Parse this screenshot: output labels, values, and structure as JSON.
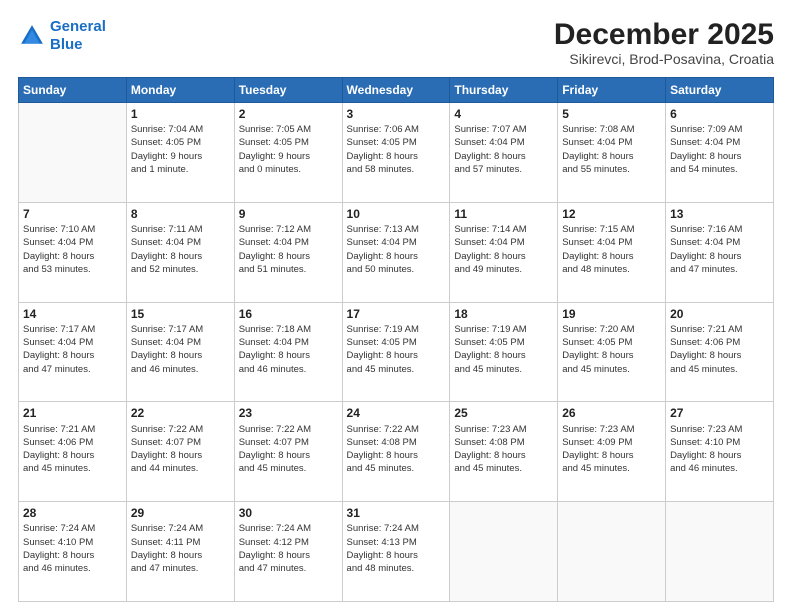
{
  "header": {
    "logo_line1": "General",
    "logo_line2": "Blue",
    "title": "December 2025",
    "subtitle": "Sikirevci, Brod-Posavina, Croatia"
  },
  "days_of_week": [
    "Sunday",
    "Monday",
    "Tuesday",
    "Wednesday",
    "Thursday",
    "Friday",
    "Saturday"
  ],
  "weeks": [
    [
      {
        "day": "",
        "info": ""
      },
      {
        "day": "1",
        "info": "Sunrise: 7:04 AM\nSunset: 4:05 PM\nDaylight: 9 hours\nand 1 minute."
      },
      {
        "day": "2",
        "info": "Sunrise: 7:05 AM\nSunset: 4:05 PM\nDaylight: 9 hours\nand 0 minutes."
      },
      {
        "day": "3",
        "info": "Sunrise: 7:06 AM\nSunset: 4:05 PM\nDaylight: 8 hours\nand 58 minutes."
      },
      {
        "day": "4",
        "info": "Sunrise: 7:07 AM\nSunset: 4:04 PM\nDaylight: 8 hours\nand 57 minutes."
      },
      {
        "day": "5",
        "info": "Sunrise: 7:08 AM\nSunset: 4:04 PM\nDaylight: 8 hours\nand 55 minutes."
      },
      {
        "day": "6",
        "info": "Sunrise: 7:09 AM\nSunset: 4:04 PM\nDaylight: 8 hours\nand 54 minutes."
      }
    ],
    [
      {
        "day": "7",
        "info": "Sunrise: 7:10 AM\nSunset: 4:04 PM\nDaylight: 8 hours\nand 53 minutes."
      },
      {
        "day": "8",
        "info": "Sunrise: 7:11 AM\nSunset: 4:04 PM\nDaylight: 8 hours\nand 52 minutes."
      },
      {
        "day": "9",
        "info": "Sunrise: 7:12 AM\nSunset: 4:04 PM\nDaylight: 8 hours\nand 51 minutes."
      },
      {
        "day": "10",
        "info": "Sunrise: 7:13 AM\nSunset: 4:04 PM\nDaylight: 8 hours\nand 50 minutes."
      },
      {
        "day": "11",
        "info": "Sunrise: 7:14 AM\nSunset: 4:04 PM\nDaylight: 8 hours\nand 49 minutes."
      },
      {
        "day": "12",
        "info": "Sunrise: 7:15 AM\nSunset: 4:04 PM\nDaylight: 8 hours\nand 48 minutes."
      },
      {
        "day": "13",
        "info": "Sunrise: 7:16 AM\nSunset: 4:04 PM\nDaylight: 8 hours\nand 47 minutes."
      }
    ],
    [
      {
        "day": "14",
        "info": "Sunrise: 7:17 AM\nSunset: 4:04 PM\nDaylight: 8 hours\nand 47 minutes."
      },
      {
        "day": "15",
        "info": "Sunrise: 7:17 AM\nSunset: 4:04 PM\nDaylight: 8 hours\nand 46 minutes."
      },
      {
        "day": "16",
        "info": "Sunrise: 7:18 AM\nSunset: 4:04 PM\nDaylight: 8 hours\nand 46 minutes."
      },
      {
        "day": "17",
        "info": "Sunrise: 7:19 AM\nSunset: 4:05 PM\nDaylight: 8 hours\nand 45 minutes."
      },
      {
        "day": "18",
        "info": "Sunrise: 7:19 AM\nSunset: 4:05 PM\nDaylight: 8 hours\nand 45 minutes."
      },
      {
        "day": "19",
        "info": "Sunrise: 7:20 AM\nSunset: 4:05 PM\nDaylight: 8 hours\nand 45 minutes."
      },
      {
        "day": "20",
        "info": "Sunrise: 7:21 AM\nSunset: 4:06 PM\nDaylight: 8 hours\nand 45 minutes."
      }
    ],
    [
      {
        "day": "21",
        "info": "Sunrise: 7:21 AM\nSunset: 4:06 PM\nDaylight: 8 hours\nand 45 minutes."
      },
      {
        "day": "22",
        "info": "Sunrise: 7:22 AM\nSunset: 4:07 PM\nDaylight: 8 hours\nand 44 minutes."
      },
      {
        "day": "23",
        "info": "Sunrise: 7:22 AM\nSunset: 4:07 PM\nDaylight: 8 hours\nand 45 minutes."
      },
      {
        "day": "24",
        "info": "Sunrise: 7:22 AM\nSunset: 4:08 PM\nDaylight: 8 hours\nand 45 minutes."
      },
      {
        "day": "25",
        "info": "Sunrise: 7:23 AM\nSunset: 4:08 PM\nDaylight: 8 hours\nand 45 minutes."
      },
      {
        "day": "26",
        "info": "Sunrise: 7:23 AM\nSunset: 4:09 PM\nDaylight: 8 hours\nand 45 minutes."
      },
      {
        "day": "27",
        "info": "Sunrise: 7:23 AM\nSunset: 4:10 PM\nDaylight: 8 hours\nand 46 minutes."
      }
    ],
    [
      {
        "day": "28",
        "info": "Sunrise: 7:24 AM\nSunset: 4:10 PM\nDaylight: 8 hours\nand 46 minutes."
      },
      {
        "day": "29",
        "info": "Sunrise: 7:24 AM\nSunset: 4:11 PM\nDaylight: 8 hours\nand 47 minutes."
      },
      {
        "day": "30",
        "info": "Sunrise: 7:24 AM\nSunset: 4:12 PM\nDaylight: 8 hours\nand 47 minutes."
      },
      {
        "day": "31",
        "info": "Sunrise: 7:24 AM\nSunset: 4:13 PM\nDaylight: 8 hours\nand 48 minutes."
      },
      {
        "day": "",
        "info": ""
      },
      {
        "day": "",
        "info": ""
      },
      {
        "day": "",
        "info": ""
      }
    ]
  ]
}
